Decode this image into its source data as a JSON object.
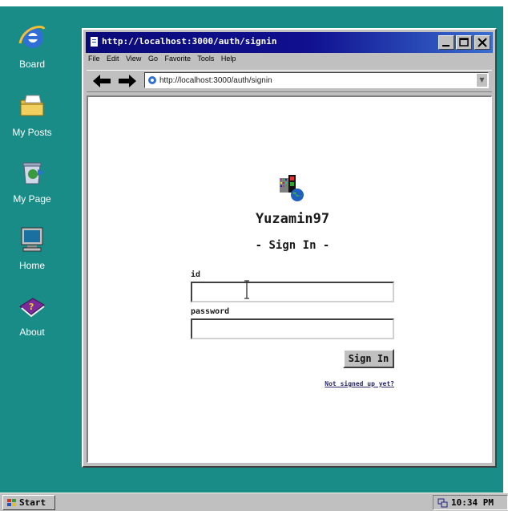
{
  "desktop": {
    "icons": [
      {
        "label": "Board",
        "icon": "internet-explorer-icon"
      },
      {
        "label": "My Posts",
        "icon": "folder-icon"
      },
      {
        "label": "My Page",
        "icon": "recycle-bin-icon"
      },
      {
        "label": "Home",
        "icon": "computer-monitor-icon"
      },
      {
        "label": "About",
        "icon": "help-book-icon"
      }
    ]
  },
  "window": {
    "title": "http://localhost:3000/auth/signin",
    "menu": [
      "File",
      "Edit",
      "View",
      "Go",
      "Favorite",
      "Tools",
      "Help"
    ],
    "address": "http://localhost:3000/auth/signin"
  },
  "page": {
    "brand": "Yuzamin97",
    "heading": "- Sign In -",
    "id_label": "id",
    "id_value": "",
    "password_label": "password",
    "password_value": "",
    "submit_label": "Sign In",
    "signup_link": "Not signed up yet?"
  },
  "taskbar": {
    "start_label": "Start",
    "clock": "10:34 PM"
  },
  "colors": {
    "desktop": "#1a8c87",
    "titlebar": "#0a0a78",
    "chrome": "#c0c0c0"
  }
}
